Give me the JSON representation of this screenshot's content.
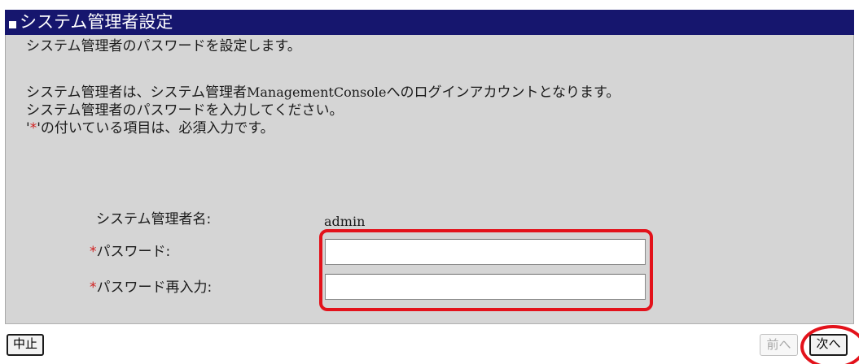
{
  "title": "システム管理者設定",
  "intro": "システム管理者のパスワードを設定します。",
  "description": {
    "line1_prefix": "システム管理者は、システム管理者",
    "line1_brand": "ManagementConsole",
    "line1_suffix": "へのログインアカウントとなります。",
    "line2": "システム管理者のパスワードを入力してください。",
    "line3_open": "'",
    "line3_mark": "*",
    "line3_rest": "'の付いている項目は、必須入力です。"
  },
  "form": {
    "admin_name_label": "システム管理者名:",
    "admin_name_value": "admin",
    "required_mark": "*",
    "password_label": "パスワード:",
    "password_value": "",
    "password_confirm_label": "パスワード再入力:",
    "password_confirm_value": ""
  },
  "buttons": {
    "cancel": "中止",
    "prev": "前へ",
    "next": "次へ"
  },
  "colors": {
    "title_bar": "#16166e",
    "panel": "#d5d5d5",
    "required": "#d02020",
    "highlight": "#e3121b"
  }
}
